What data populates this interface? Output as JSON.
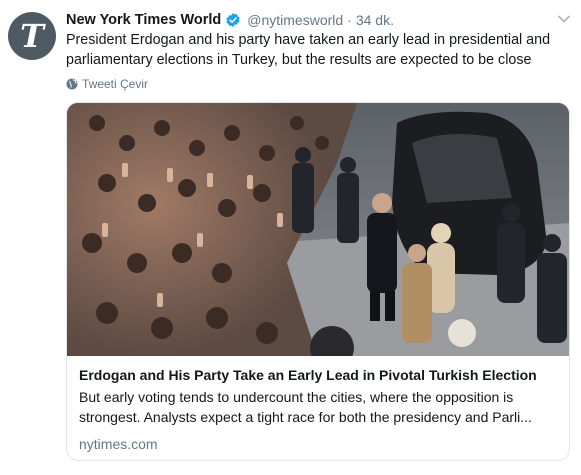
{
  "tweet": {
    "display_name": "New York Times World",
    "handle": "@nytimesworld",
    "separator": "·",
    "time": "34 dk.",
    "avatar_letter": "T",
    "text": "President Erdogan and his party have taken an early lead in presidential and parliamentary elections in Turkey, but the results are expected to be close",
    "translate_label": "Tweeti Çevir"
  },
  "card": {
    "title": "Erdogan and His Party Take an Early Lead in Pivotal Turkish Election",
    "description": "But early voting tends to undercount the cities, where the opposition is strongest. Analysts expect a tight race for both the presidency and Parli...",
    "domain": "nytimes.com",
    "image_alt": "Crowd reaching toward Erdogan beside a black car"
  },
  "icons": {
    "verified": "verified-badge-icon",
    "caret": "chevron-down-icon",
    "translate": "globe-icon"
  },
  "colors": {
    "verified_blue": "#1da1f2",
    "muted_text": "#657786",
    "border": "#e1e8ed",
    "avatar_bg": "#4e5a63"
  }
}
